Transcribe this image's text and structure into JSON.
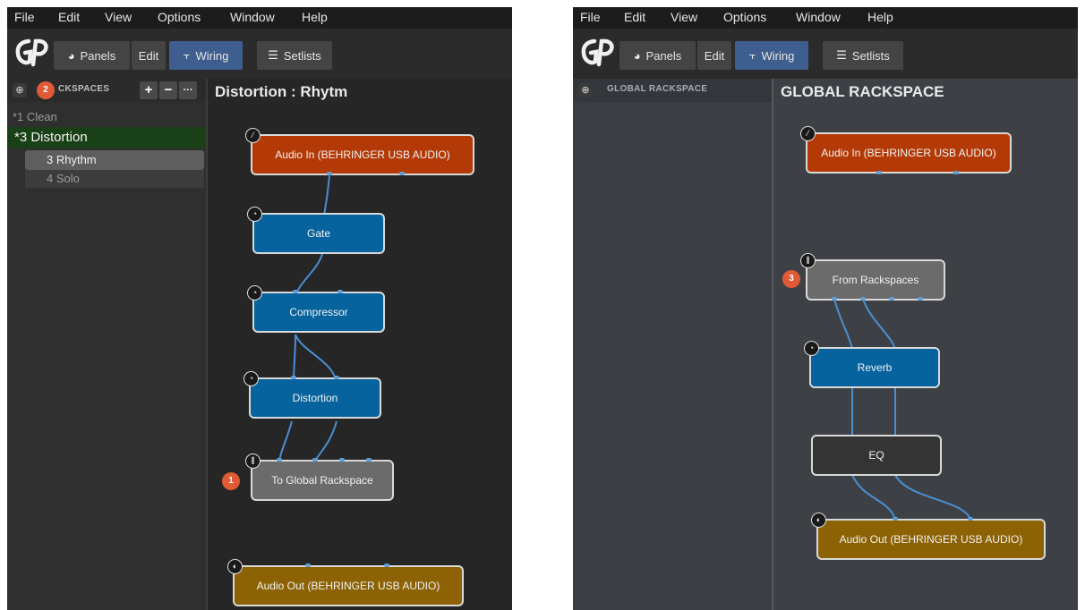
{
  "menu": [
    "File",
    "Edit",
    "View",
    "Options",
    "Window",
    "Help"
  ],
  "toolbar": {
    "panels": "Panels",
    "edit": "Edit",
    "wiring": "Wiring",
    "setlists": "Setlists"
  },
  "left": {
    "sidebar_title": "CKSPACES",
    "sidebar_buttons": {
      "add": "+",
      "remove": "−",
      "more": "···"
    },
    "rackspaces": [
      {
        "label": "*1  Clean"
      },
      {
        "label": "*3  Distortion"
      },
      {
        "label": "3  Rhythm"
      },
      {
        "label": "4  Solo"
      }
    ],
    "canvas_title": "Distortion : Rhytm",
    "blocks": {
      "audio_in": "Audio In (BEHRINGER USB AUDIO)",
      "gate": "Gate",
      "compressor": "Compressor",
      "distortion": "Distortion",
      "to_global": "To Global Rackspace",
      "audio_out": "Audio Out (BEHRINGER USB AUDIO)"
    },
    "badges": {
      "sidebar": "2",
      "to_global": "1"
    }
  },
  "right": {
    "sidebar_title": "GLOBAL RACKSPACE",
    "canvas_title": "GLOBAL RACKSPACE",
    "blocks": {
      "audio_in": "Audio In (BEHRINGER USB AUDIO)",
      "from_rackspaces": "From Rackspaces",
      "reverb": "Reverb",
      "eq": "EQ",
      "audio_out": "Audio Out (BEHRINGER USB AUDIO)"
    },
    "badges": {
      "from_rackspaces": "3"
    }
  },
  "colors": {
    "input_block": "#b33a07",
    "plugin_block": "#06639d",
    "global_block": "#6b6b6b",
    "output_block": "#8c6204",
    "badge": "#e05a36",
    "active_tab": "#3e5e8f",
    "selected_rackspace": "#1a4018"
  },
  "icons": {
    "logo": "gig-performer-logo",
    "panels": "panels-icon",
    "wiring": "wiring-icon",
    "setlists": "setlists-icon",
    "globe": "globe-icon"
  }
}
